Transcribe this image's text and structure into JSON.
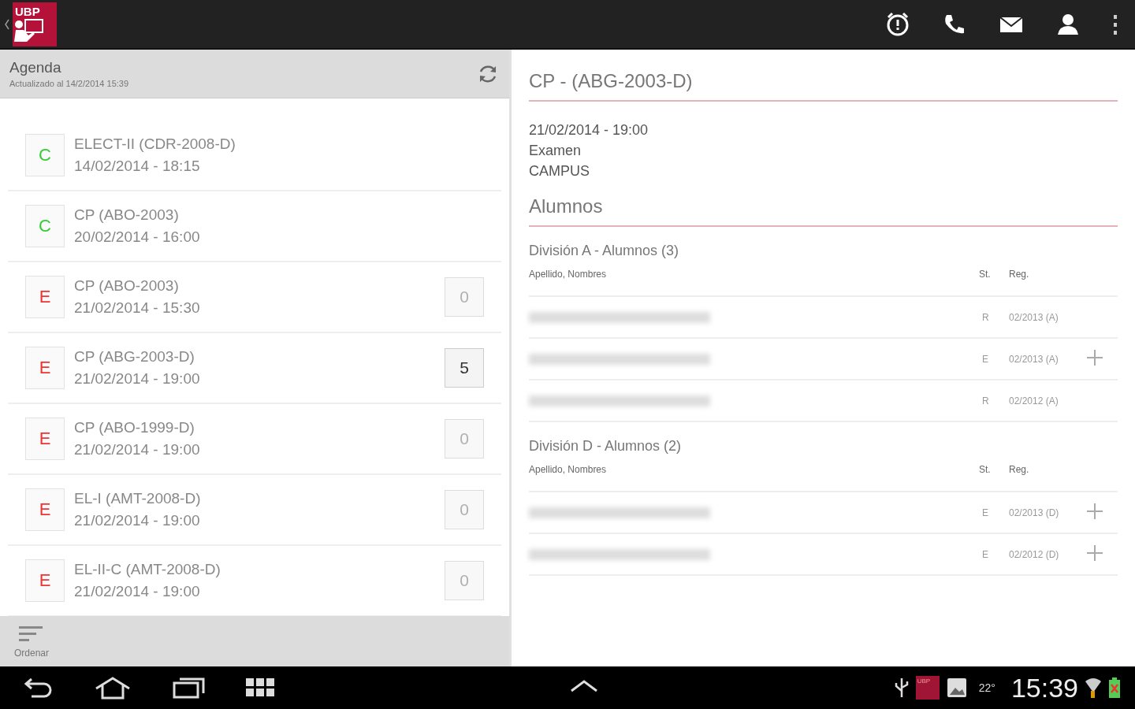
{
  "app_bar": {
    "logo_text": "UBP"
  },
  "agenda": {
    "title": "Agenda",
    "updated": "Actualizado al 14/2/2014 15:39",
    "items": [
      {
        "badge": "C",
        "color": "#33cc33",
        "title": "ELECT-II (CDR-2008-D)",
        "datetime": "14/02/2014 - 18:15"
      },
      {
        "badge": "C",
        "color": "#33cc33",
        "title": "CP (ABO-2003)",
        "datetime": "20/02/2014 - 16:00"
      },
      {
        "badge": "E",
        "color": "#ee3333",
        "title": "CP (ABO-2003)",
        "datetime": "21/02/2014 - 15:30",
        "count": "0",
        "active": false
      },
      {
        "badge": "E",
        "color": "#ee3333",
        "title": "CP (ABG-2003-D)",
        "datetime": "21/02/2014 - 19:00",
        "count": "5",
        "active": true
      },
      {
        "badge": "E",
        "color": "#ee3333",
        "title": "CP (ABO-1999-D)",
        "datetime": "21/02/2014 - 19:00",
        "count": "0",
        "active": false
      },
      {
        "badge": "E",
        "color": "#ee3333",
        "title": "EL-I (AMT-2008-D)",
        "datetime": "21/02/2014 - 19:00",
        "count": "0",
        "active": false
      },
      {
        "badge": "E",
        "color": "#ee3333",
        "title": "EL-II-C (AMT-2008-D)",
        "datetime": "21/02/2014 - 19:00",
        "count": "0",
        "active": false
      }
    ],
    "sort_label": "Ordenar"
  },
  "detail": {
    "title": "CP - (ABG-2003-D)",
    "lines": [
      "21/02/2014 - 19:00",
      "Examen",
      "CAMPUS"
    ],
    "students_heading": "Alumnos",
    "divisions": [
      {
        "heading": "División A - Alumnos (3)",
        "columns": [
          "Apellido, Nombres",
          "St.",
          "Reg."
        ],
        "rows": [
          {
            "st": "R",
            "reg": "02/2013 (A)",
            "addable": false
          },
          {
            "st": "E",
            "reg": "02/2013 (A)",
            "addable": true
          },
          {
            "st": "R",
            "reg": "02/2012 (A)",
            "addable": false
          }
        ]
      },
      {
        "heading": "División D - Alumnos (2)",
        "columns": [
          "Apellido, Nombres",
          "St.",
          "Reg."
        ],
        "rows": [
          {
            "st": "E",
            "reg": "02/2013 (D)",
            "addable": true
          },
          {
            "st": "E",
            "reg": "02/2012 (D)",
            "addable": true
          }
        ]
      }
    ]
  },
  "system_bar": {
    "notification_label": "UBP",
    "temperature": "22°",
    "clock": "15:39"
  }
}
